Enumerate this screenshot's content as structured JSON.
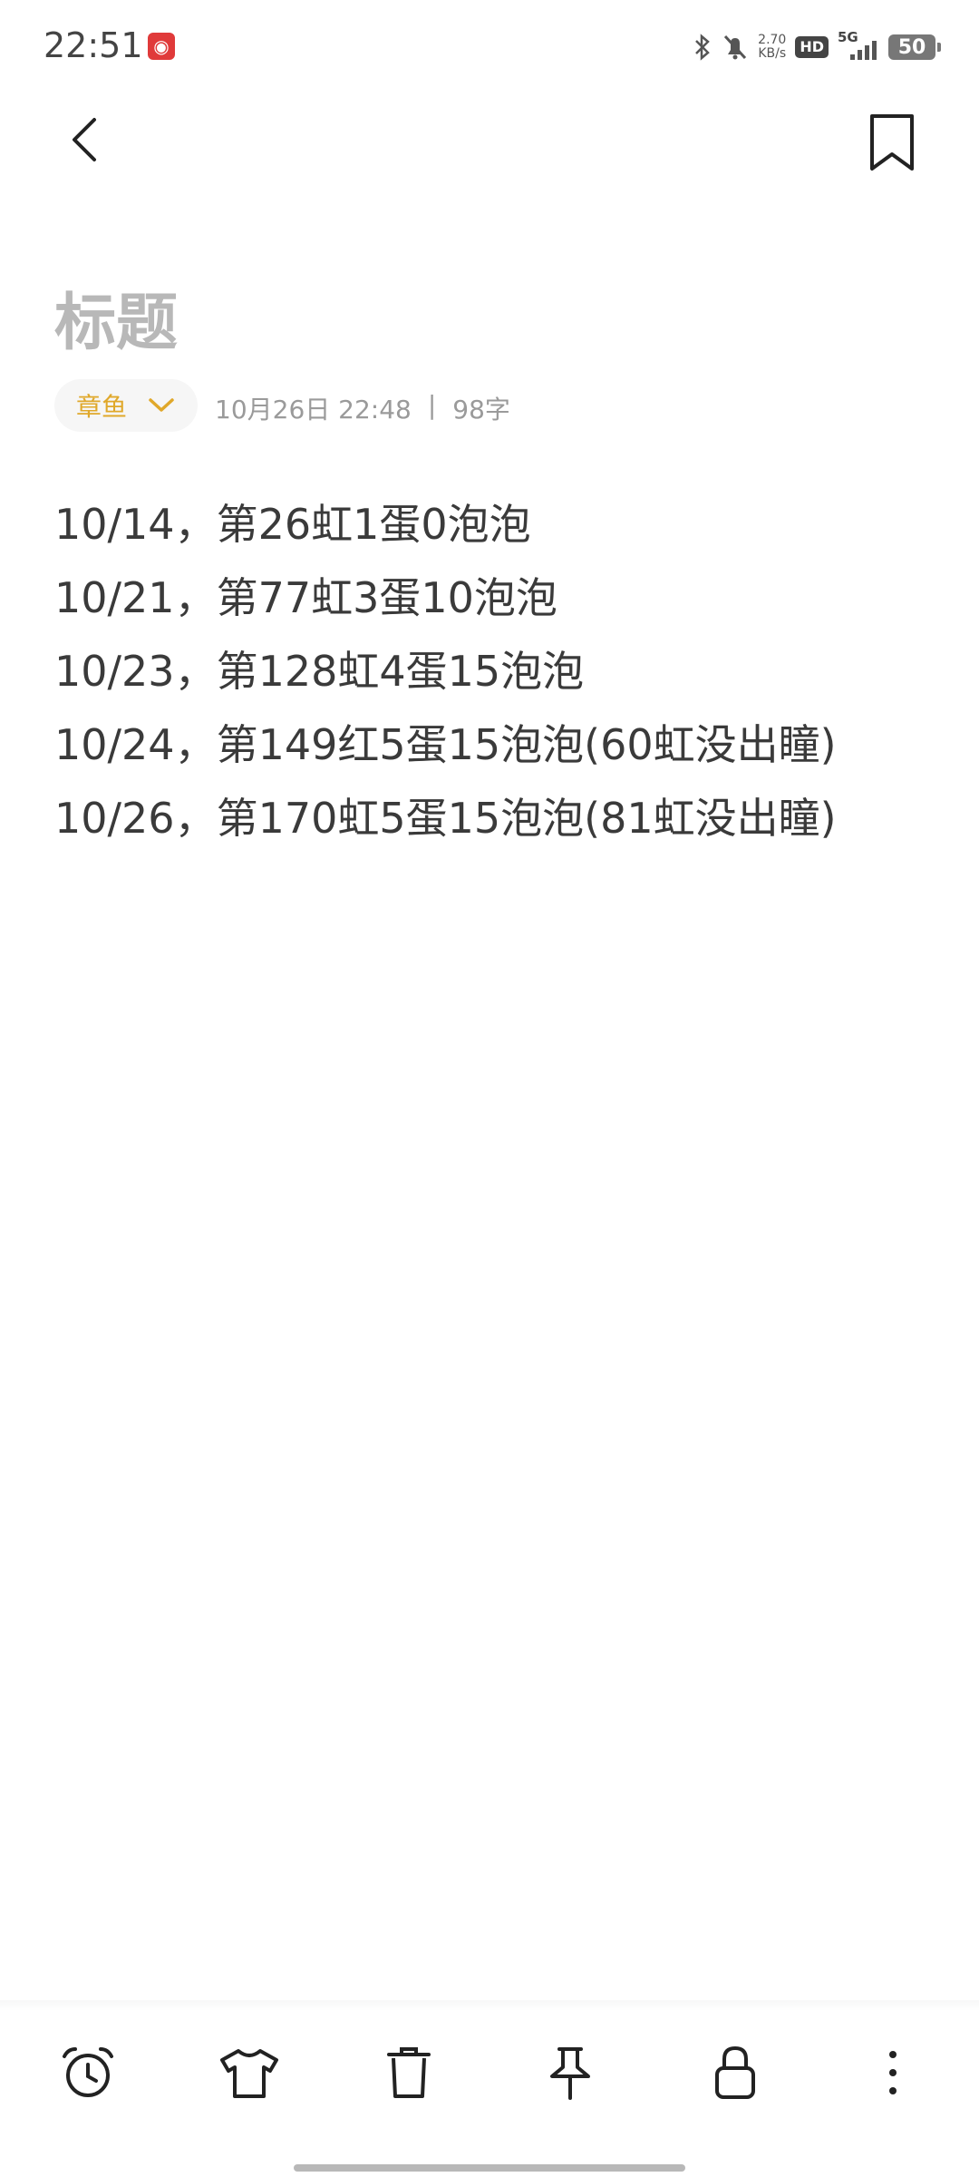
{
  "status_bar": {
    "time": "22:51",
    "net_speed_value": "2.70",
    "net_speed_unit": "KB/s",
    "hd": "HD",
    "network": "5G",
    "battery": "50"
  },
  "header": {
    "back_icon": "chevron-left-icon",
    "bookmark_icon": "bookmark-icon"
  },
  "note": {
    "title_placeholder": "标题",
    "folder": "章鱼",
    "date": "10月26日 22:48",
    "separator": "|",
    "word_count": "98字",
    "lines": [
      "10/14，第26虹1蛋0泡泡",
      "10/21，第77虹3蛋10泡泡",
      "10/23，第128虹4蛋15泡泡",
      "10/24，第149红5蛋15泡泡(60虹没出瞳)",
      "10/26，第170虹5蛋15泡泡(81虹没出瞳)"
    ]
  },
  "toolbar": {
    "icons": [
      "alarm-clock-icon",
      "shirt-icon",
      "trash-icon",
      "pin-icon",
      "lock-icon",
      "more-vertical-icon"
    ]
  },
  "colors": {
    "accent": "#e0a82a",
    "title_placeholder": "#b8b8b8",
    "meta_text": "#9a9a9a",
    "body_text": "#3a3a3a"
  }
}
